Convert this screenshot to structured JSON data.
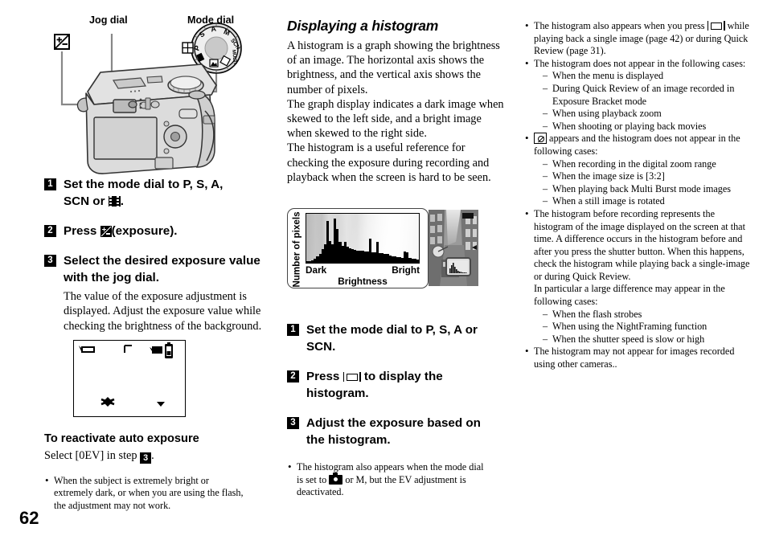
{
  "page": {
    "number": "62"
  },
  "figure_camera": {
    "label_jog": "Jog dial",
    "label_mode": "Mode dial",
    "mode_dial_positions": [
      "S",
      "A",
      "M",
      "SCN",
      " ",
      "P"
    ],
    "ev_button_icon": "exposure-icon"
  },
  "left_column": {
    "steps": [
      {
        "num": "1",
        "text_before": "Set the mode dial to P, S, A,",
        "text_line2_before": "SCN or ",
        "icon": "movie-mode-icon",
        "text_after": "."
      },
      {
        "num": "2",
        "text_before": "Press ",
        "icon": "exposure-icon",
        "text_after": "(exposure)."
      },
      {
        "num": "3",
        "text_before": "Select the desired exposure value with the jog dial.",
        "sub": "The value of the exposure adjustment is displayed. Adjust the exposure value while checking the brightness of the background."
      }
    ],
    "lcd_icons": [
      "battery-icon",
      "af-frame-icon",
      "record-mode-icon",
      "battery-level-icon",
      "macro-icon",
      "menu-arrow-icon"
    ],
    "reactivate_heading": "To reactivate auto exposure",
    "reactivate_text_before": "Select [0EV] in step ",
    "reactivate_step": "3",
    "reactivate_text_after": ".",
    "notes": [
      "When the subject is extremely bright or extremely dark, or when you are using the flash, the adjustment may not work."
    ]
  },
  "middle_column": {
    "heading": "Displaying a histogram",
    "paragraphs": [
      "A histogram is a graph showing the brightness of an image. The horizontal axis shows the brightness, and the vertical axis shows the number of pixels.",
      "The graph display indicates a dark image when skewed to the left side, and a bright image when skewed to the right side.",
      "The histogram is a useful reference for checking the exposure during recording and playback when the screen is hard to be seen."
    ],
    "steps": [
      {
        "num": "1",
        "text_before": "Set the mode dial to P, S, A or SCN."
      },
      {
        "num": "2",
        "text_before": "Press ",
        "icon": "display-button-icon",
        "text_after": " to display the histogram."
      },
      {
        "num": "3",
        "text_before": "Adjust the exposure based on the histogram."
      }
    ],
    "notes_before_icon": "The histogram also appears when the mode dial is set to ",
    "notes_icon": "still-camera-icon",
    "notes_after_icon": " or M, but the EV adjustment is deactivated."
  },
  "right_column": {
    "notes": [
      {
        "type": "bullet_with_icon",
        "text_before": "The histogram also appears when you press ",
        "icon": "display-button-icon",
        "text_after": " while playing back a single image (page 42) or during Quick Review (page 31)."
      },
      {
        "type": "bullet",
        "text": "The histogram does not appear in the following cases:",
        "sub_items": [
          "When the menu is displayed",
          "During Quick Review of an image recorded in Exposure Bracket mode",
          "When using playback zoom",
          "When shooting or playing back movies"
        ]
      },
      {
        "type": "bullet_icon_lead",
        "icon": "no-histogram-icon",
        "text_after": " appears and the histogram does not appear in the following cases:",
        "sub_items": [
          "When recording in the digital zoom range",
          "When the image size is [3:2]",
          "When playing back Multi Burst mode images",
          "When a still image is rotated"
        ]
      },
      {
        "type": "bullet",
        "text": "The histogram before recording represents the histogram of the image displayed on the screen at that time. A difference occurs in the histogram before and after you press the shutter button. When this happens, check the histogram while playing back a single-image or during Quick Review.",
        "text2": "In particular a large difference may appear in the following cases:",
        "sub_items": [
          "When the flash strobes",
          "When using the NightFraming function",
          "When the shutter speed is slow or high"
        ]
      },
      {
        "type": "bullet",
        "text": "The histogram may not appear for images recorded using other cameras.."
      }
    ]
  },
  "chart_data": {
    "type": "bar",
    "title": "",
    "xlabel": "Brightness",
    "ylabel": "Number of pixels",
    "x_tick_labels": [
      "Dark",
      "Bright"
    ],
    "categories": [
      "0",
      "1",
      "2",
      "3",
      "4",
      "5",
      "6",
      "7",
      "8",
      "9",
      "10",
      "11",
      "12",
      "13",
      "14",
      "15",
      "16",
      "17",
      "18",
      "19",
      "20",
      "21",
      "22",
      "23",
      "24",
      "25",
      "26",
      "27",
      "28",
      "29",
      "30",
      "31",
      "32",
      "33",
      "34",
      "35",
      "36",
      "37",
      "38",
      "39",
      "40",
      "41",
      "42",
      "43",
      "44"
    ],
    "values": [
      2,
      3,
      4,
      6,
      10,
      14,
      22,
      30,
      68,
      36,
      30,
      72,
      55,
      34,
      27,
      34,
      26,
      24,
      22,
      21,
      20,
      20,
      20,
      19,
      18,
      40,
      17,
      17,
      34,
      16,
      16,
      15,
      14,
      12,
      10,
      10,
      9,
      9,
      8,
      18,
      17,
      8,
      7,
      6,
      5
    ],
    "ylim": [
      0,
      80
    ],
    "grid": false,
    "legend": "none"
  }
}
